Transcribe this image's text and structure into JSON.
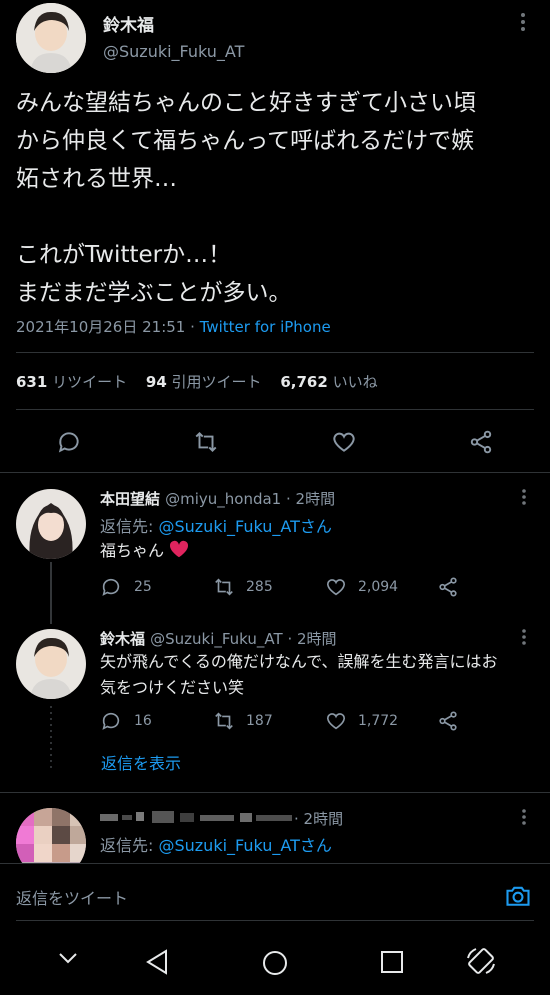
{
  "tweet": {
    "author_name": "鈴木福",
    "author_handle": "@Suzuki_Fuku_AT",
    "text": "みんな望結ちゃんのこと好きすぎて小さい頃\nから仲良くて福ちゃんって呼ばれるだけで嫉\n妬される世界…\n\nこれがTwitterか…！\nまだまだ学ぶことが多い。",
    "timestamp": "2021年10月26日 21:51",
    "separator": " · ",
    "client": "Twitter for iPhone",
    "retweets_count": "631",
    "retweets_label": "リツイート",
    "quotes_count": "94",
    "quotes_label": "引用ツイート",
    "likes_count": "6,762",
    "likes_label": "いいね"
  },
  "replies": [
    {
      "name": "本田望結",
      "handle": "@miyu_honda1",
      "time": " · 2時間",
      "reply_to_label": "返信先: ",
      "reply_to_handle": "@Suzuki_Fuku_ATさん",
      "text": "福ちゃん",
      "emoji": "heart",
      "reply_count": "25",
      "retweet_count": "285",
      "like_count": "2,094"
    },
    {
      "name": "鈴木福",
      "handle": "@Suzuki_Fuku_AT",
      "time": " · 2時間",
      "text": "矢が飛んでくるの俺だけなんで、誤解を生む発言にはお\n気をつけください笑",
      "reply_count": "16",
      "retweet_count": "187",
      "like_count": "1,772"
    },
    {
      "time": " · 2時間",
      "reply_to_label": "返信先: ",
      "reply_to_handle": "@Suzuki_Fuku_ATさん"
    }
  ],
  "show_replies_label": "返信を表示",
  "reply_bar": {
    "placeholder": "返信をツイート"
  },
  "icons": {
    "reply": "reply-icon",
    "retweet": "retweet-icon",
    "like": "heart-icon",
    "share": "share-icon",
    "camera": "camera-icon"
  },
  "colors": {
    "accent": "#1d9bf0",
    "background": "#000000",
    "text": "#e7e9ea",
    "muted": "#8b98a5",
    "heart": "#f91880"
  }
}
